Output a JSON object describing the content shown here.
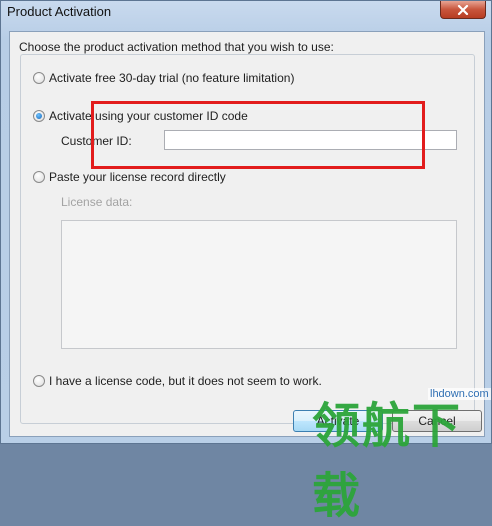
{
  "window": {
    "title": "Product Activation",
    "close_icon": "close-icon"
  },
  "dialog": {
    "prompt": "Choose the product activation method that you wish to use:",
    "options": [
      {
        "label": "Activate free 30-day trial (no feature limitation)",
        "checked": false
      },
      {
        "label": "Activate using your customer ID code",
        "checked": true
      },
      {
        "label": "Paste your license record directly",
        "checked": false
      },
      {
        "label": "I have a license code, but it does not seem to work.",
        "checked": false
      }
    ],
    "customer_id": {
      "label": "Customer ID:",
      "value": ""
    },
    "license_data": {
      "label": "License data:",
      "value": ""
    },
    "buttons": {
      "activate": "Activate",
      "cancel": "Cancel"
    }
  },
  "watermark": {
    "text": "领航下载",
    "url": "lhdown.com"
  },
  "colors": {
    "highlight": "#e21c1c",
    "watermark": "#2ca53a"
  }
}
